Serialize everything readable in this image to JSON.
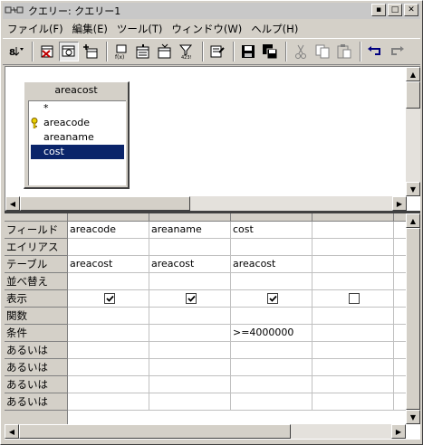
{
  "window": {
    "title": "クエリー:  クエリー1",
    "controls": {
      "minimize": "▪",
      "maximize": "□",
      "close": "✕"
    }
  },
  "menu": [
    "ファイル(F)",
    "編集(E)",
    "ツール(T)",
    "ウィンドウ(W)",
    "ヘルプ(H)"
  ],
  "toolbar": {
    "icons": [
      "query-type-icon",
      "delete-table-icon",
      "show-table-icon",
      "add-table-icon",
      "sql-icon",
      "properties-icon",
      "join-icon",
      "sort-icon",
      "criteria-icon",
      "save-icon",
      "save-all-icon",
      "cut-icon",
      "copy-icon",
      "paste-icon",
      "undo-icon",
      "redo-icon"
    ]
  },
  "table_box": {
    "name": "areacost",
    "fields": [
      "*",
      "areacode",
      "areaname",
      "cost"
    ],
    "key_field_index": 1,
    "selected_field_index": 3
  },
  "grid": {
    "row_headers": [
      "フィールド",
      "エイリアス",
      "テーブル",
      "並べ替え",
      "表示",
      "関数",
      "条件",
      "あるいは",
      "あるいは",
      "あるいは",
      "あるいは"
    ],
    "columns": [
      {
        "field": "areacode",
        "alias": "",
        "table": "areacost",
        "sort": "",
        "show": true,
        "function": "",
        "criteria": ""
      },
      {
        "field": "areaname",
        "alias": "",
        "table": "areacost",
        "sort": "",
        "show": true,
        "function": "",
        "criteria": ""
      },
      {
        "field": "cost",
        "alias": "",
        "table": "areacost",
        "sort": "",
        "show": true,
        "function": "",
        "criteria": ">=4000000"
      },
      {
        "field": "",
        "alias": "",
        "table": "",
        "sort": "",
        "show": false,
        "function": "",
        "criteria": ""
      }
    ]
  }
}
